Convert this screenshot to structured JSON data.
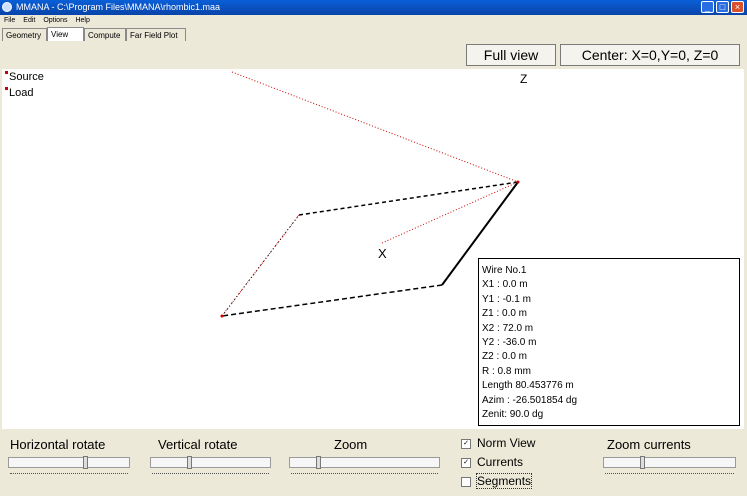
{
  "window": {
    "title": "MMANA - C:\\Program Files\\MMANA\\rhombic1.maa"
  },
  "menu": [
    "File",
    "Edit",
    "Options",
    "Help"
  ],
  "tabs": [
    "Geometry",
    "View",
    "Compute",
    "Far Field Plot"
  ],
  "active_tab": "View",
  "toolbar": {
    "full_view": "Full view",
    "center": "Center: X=0,Y=0, Z=0"
  },
  "view": {
    "axis_label": "Z",
    "origin_mark": "X",
    "legend": [
      "Source",
      "Load"
    ]
  },
  "wire_info": [
    "Wire No.1",
    "X1   : 0.0 m",
    "Y1   : -0.1 m",
    "Z1   : 0.0 m",
    "X2   : 72.0 m",
    "Y2   : -36.0 m",
    "Z2   : 0.0 m",
    "R    : 0.8 mm",
    "Length 80.453776 m",
    "Azim : -26.501854 dg",
    "Zenit: 90.0 dg"
  ],
  "controls": {
    "horizontal_rotate": "Horizontal rotate",
    "vertical_rotate": "Vertical rotate",
    "zoom": "Zoom",
    "zoom_currents": "Zoom currents",
    "norm_view": {
      "label": "Norm View",
      "checked": true
    },
    "currents": {
      "label": "Currents",
      "checked": true
    },
    "segments": {
      "label": "Segments",
      "checked": false
    }
  },
  "colors": {
    "title_bar": "#0a5fd8",
    "wire": "#000000",
    "current": "#cc0000"
  }
}
